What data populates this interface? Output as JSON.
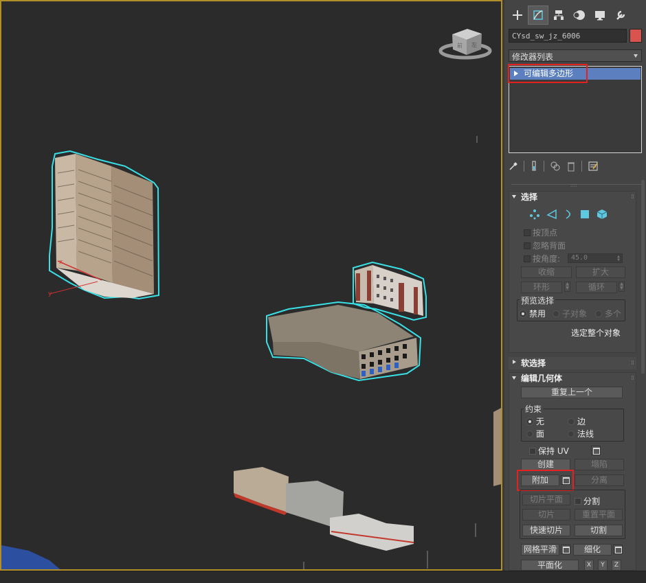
{
  "panel": {
    "tabs": [
      "create-icon",
      "modify-icon",
      "hierarchy-icon",
      "motion-icon",
      "display-icon",
      "utilities-icon"
    ],
    "object_name": "CYsd_sw_jz_6006",
    "object_color": "#d9534f",
    "modifier_list_label": "修改器列表",
    "stack_item": "可编辑多边形"
  },
  "selection": {
    "title": "选择",
    "by_vertex": "按顶点",
    "ignore_backfacing": "忽略背面",
    "by_angle": "按角度:",
    "angle_value": "45.0",
    "shrink": "收缩",
    "grow": "扩大",
    "ring": "环形",
    "loop": "循环",
    "preview_group": "预览选择",
    "preview_off": "禁用",
    "preview_subobj": "子对象",
    "preview_multi": "多个",
    "whole_object": "选定整个对象"
  },
  "soft_selection": {
    "title": "软选择"
  },
  "edit_geometry": {
    "title": "编辑几何体",
    "repeat_last": "重复上一个",
    "constraints_group": "约束",
    "c_none": "无",
    "c_edge": "边",
    "c_face": "面",
    "c_normal": "法线",
    "preserve_uv": "保持 UV",
    "create": "创建",
    "collapse": "塌陷",
    "attach": "附加",
    "detach": "分离",
    "slice_plane": "切片平面",
    "split": "分割",
    "slice": "切片",
    "reset_plane": "重置平面",
    "quickslice": "快速切片",
    "cut": "切割",
    "meshsmooth": "网格平滑",
    "tessellate": "细化",
    "make_planar": "平面化",
    "x": "X",
    "y": "Y",
    "z": "Z"
  },
  "viewport": {
    "axis_x": "x",
    "axis_y": "y",
    "viewcube_front": "前",
    "viewcube_left": "左"
  }
}
